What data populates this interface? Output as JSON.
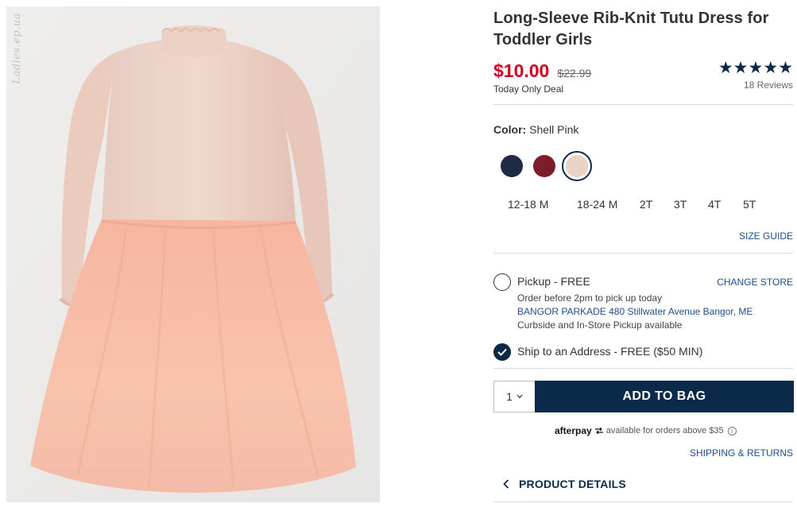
{
  "image": {
    "alt": "",
    "watermark": "Ladies.ep.ua"
  },
  "product": {
    "title": "Long-Sleeve Rib-Knit Tutu Dress for Toddler Girls",
    "sale_price": "$10.00",
    "regular_price": "$22.99",
    "deal_label": "Today Only Deal",
    "stars": "★★★★★",
    "reviews": "18 Reviews"
  },
  "color": {
    "label": "Color:",
    "value": "Shell Pink",
    "swatches": [
      {
        "name": "navy",
        "hex": "#1f2a44"
      },
      {
        "name": "burgundy",
        "hex": "#7b1d2a"
      },
      {
        "name": "shell-pink",
        "hex": "#e8d3c4",
        "selected": true
      }
    ]
  },
  "sizes": [
    "12-18 M",
    "18-24 M",
    "2T",
    "3T",
    "4T",
    "5T"
  ],
  "size_guide": "SIZE GUIDE",
  "fulfillment": {
    "pickup_label": "Pickup - FREE",
    "change_store": "CHANGE STORE",
    "pickup_note": "Order before 2pm to pick up today",
    "store_address": "BANGOR PARKADE 480 Stillwater Avenue  Bangor, ME",
    "pickup_availability": "Curbside and In-Store Pickup available",
    "ship_label": "Ship to an Address - FREE ($50 MIN)"
  },
  "cart": {
    "quantity": "1",
    "add_to_bag": "ADD TO BAG"
  },
  "afterpay": {
    "brand": "afterpay",
    "text": "available for orders above $35"
  },
  "shipping_returns": "SHIPPING & RETURNS",
  "product_details": "PRODUCT DETAILS",
  "colors": {
    "navy_button": "#0b2a4a",
    "sale_red": "#d0021b",
    "link_blue": "#1d4e89"
  }
}
